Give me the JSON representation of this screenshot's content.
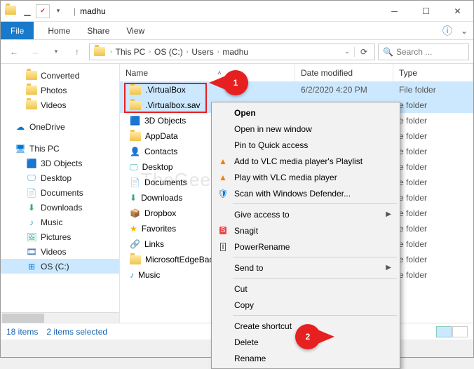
{
  "titlebar": {
    "title": "madhu"
  },
  "ribbon": {
    "file": "File",
    "tabs": [
      "Home",
      "Share",
      "View"
    ]
  },
  "breadcrumb": {
    "items": [
      "This PC",
      "OS (C:)",
      "Users",
      "madhu"
    ]
  },
  "search": {
    "placeholder": "Search ..."
  },
  "tree": {
    "quickaccess": [
      {
        "label": "Converted",
        "icon": "folder"
      },
      {
        "label": "Photos",
        "icon": "folder"
      },
      {
        "label": "Videos",
        "icon": "folder"
      }
    ],
    "onedrive": "OneDrive",
    "thispc": "This PC",
    "thispc_children": [
      {
        "label": "3D Objects",
        "icon": "3d"
      },
      {
        "label": "Desktop",
        "icon": "desktop"
      },
      {
        "label": "Documents",
        "icon": "documents"
      },
      {
        "label": "Downloads",
        "icon": "downloads"
      },
      {
        "label": "Music",
        "icon": "music"
      },
      {
        "label": "Pictures",
        "icon": "pictures"
      },
      {
        "label": "Videos",
        "icon": "videos"
      },
      {
        "label": "OS (C:)",
        "icon": "drive",
        "selected": true
      }
    ]
  },
  "columns": {
    "name": "Name",
    "date": "Date modified",
    "type": "Type"
  },
  "rows": [
    {
      "name": ".VirtualBox",
      "date": "6/2/2020 4:20 PM",
      "type": "File folder",
      "icon": "folder",
      "selected": true
    },
    {
      "name": ".Virtualbox.sav",
      "date": "",
      "type": "e folder",
      "icon": "folder",
      "selected": true
    },
    {
      "name": "3D Objects",
      "date": "",
      "type": "e folder",
      "icon": "3d"
    },
    {
      "name": "AppData",
      "date": "",
      "type": "e folder",
      "icon": "folder"
    },
    {
      "name": "Contacts",
      "date": "",
      "type": "e folder",
      "icon": "contacts"
    },
    {
      "name": "Desktop",
      "date": "",
      "type": "e folder",
      "icon": "desktop"
    },
    {
      "name": "Documents",
      "date": "",
      "type": "e folder",
      "icon": "documents"
    },
    {
      "name": "Downloads",
      "date": "",
      "type": "e folder",
      "icon": "downloads"
    },
    {
      "name": "Dropbox",
      "date": "",
      "type": "e folder",
      "icon": "dropbox"
    },
    {
      "name": "Favorites",
      "date": "",
      "type": "e folder",
      "icon": "favorites"
    },
    {
      "name": "Links",
      "date": "",
      "type": "e folder",
      "icon": "links"
    },
    {
      "name": "MicrosoftEdgeBacku",
      "date": "",
      "type": "e folder",
      "icon": "folder"
    },
    {
      "name": "Music",
      "date": "",
      "type": "e folder",
      "icon": "music"
    }
  ],
  "contextmenu": [
    {
      "label": "Open",
      "bold": true
    },
    {
      "label": "Open in new window"
    },
    {
      "label": "Pin to Quick access"
    },
    {
      "label": "Add to VLC media player's Playlist",
      "icon": "vlc"
    },
    {
      "label": "Play with VLC media player",
      "icon": "vlc"
    },
    {
      "label": "Scan with Windows Defender...",
      "icon": "shield"
    },
    {
      "sep": true
    },
    {
      "label": "Give access to",
      "arrow": true
    },
    {
      "label": "Snagit",
      "icon": "snagit"
    },
    {
      "label": "PowerRename",
      "icon": "rename"
    },
    {
      "sep": true
    },
    {
      "label": "Send to",
      "arrow": true
    },
    {
      "sep": true
    },
    {
      "label": "Cut"
    },
    {
      "label": "Copy"
    },
    {
      "sep": true
    },
    {
      "label": "Create shortcut"
    },
    {
      "label": "Delete"
    },
    {
      "label": "Rename"
    }
  ],
  "status": {
    "count": "18 items",
    "selected": "2 items selected"
  },
  "callouts": {
    "one": "1",
    "two": "2"
  },
  "watermark": "TheGeekPage"
}
